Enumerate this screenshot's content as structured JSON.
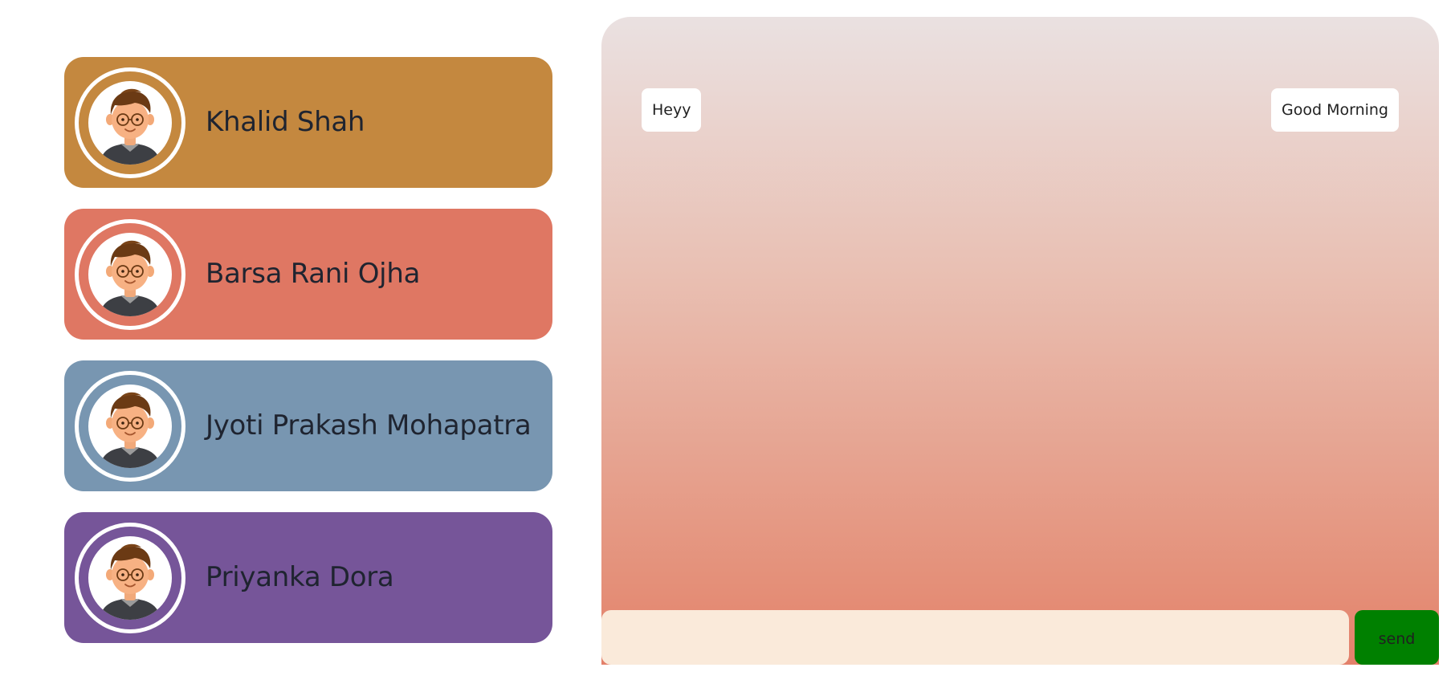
{
  "contacts": [
    {
      "name": "Khalid Shah",
      "color": "#c4883f",
      "avatar_icon": "boy-avatar-icon"
    },
    {
      "name": "Barsa Rani Ojha",
      "color": "#df7763",
      "avatar_icon": "boy-avatar-icon"
    },
    {
      "name": "Jyoti Prakash Mohapatra",
      "color": "#7896b1",
      "avatar_icon": "boy-avatar-icon"
    },
    {
      "name": "Priyanka Dora",
      "color": "#765599",
      "avatar_icon": "boy-avatar-icon"
    }
  ],
  "chat": {
    "gradient_top": "#eae1e1",
    "gradient_bottom": "#e3806a",
    "messages": [
      {
        "text": "Heyy",
        "side": "left"
      },
      {
        "text": "Good Morning",
        "side": "right"
      }
    ]
  },
  "composer": {
    "input_value": "",
    "input_placeholder": "",
    "input_color": "#faeada",
    "send_label": "send",
    "send_color": "#008000"
  }
}
